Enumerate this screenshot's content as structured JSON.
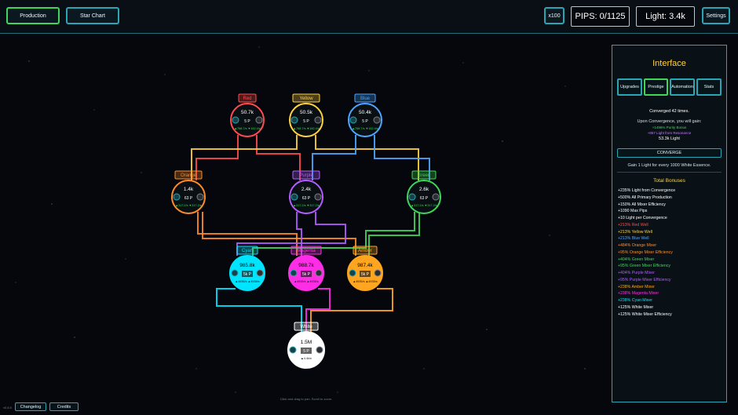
{
  "header": {
    "production_label": "Production",
    "star_chart_label": "Star Chart",
    "multiplier_label": "x100",
    "pips": "PIPS: 0/1125",
    "light": "Light: 3.4k",
    "settings_label": "Settings"
  },
  "nodes": [
    {
      "id": "red",
      "label": "Red",
      "value": "50.7k",
      "pips": "5 P",
      "rate": "▲768.7/s ▼162.4/s",
      "color": "#ff4d4d"
    },
    {
      "id": "yellow",
      "label": "Yellow",
      "value": "50.5k",
      "pips": "5 P",
      "rate": "▲768.7/s ▼162.4/s",
      "color": "#ffd23f"
    },
    {
      "id": "blue",
      "label": "Blue",
      "value": "50.4k",
      "pips": "5 P",
      "rate": "▲768.7/s ▼162.4/s",
      "color": "#4da6ff"
    },
    {
      "id": "orange",
      "label": "Orange",
      "value": "1.4k",
      "pips": "63 P",
      "rate": "▲317.2/s ▼317.2/s",
      "color": "#ff8c2a"
    },
    {
      "id": "purple",
      "label": "Purple",
      "value": "2.4k",
      "pips": "63 P",
      "rate": "▲317.2/s ▼317.2/s",
      "color": "#b35cff"
    },
    {
      "id": "green",
      "label": "Green",
      "value": "2.6k",
      "pips": "63 P",
      "rate": "▲317.2/s ▼317.2/s",
      "color": "#3fd65a"
    },
    {
      "id": "cyan",
      "label": "Cyan",
      "value": "985.8k",
      "pips": "5k P",
      "rate": "▲4935/s ▲4935/s",
      "color": "#00e5ff"
    },
    {
      "id": "magenta",
      "label": "Magenta",
      "value": "988.7k",
      "pips": "5k P",
      "rate": "▲4935/s ▲4935/s",
      "color": "#ff2ee6"
    },
    {
      "id": "amber",
      "label": "Amber",
      "value": "987.4k",
      "pips": "5k P",
      "rate": "▲4935/s ▲4935/s",
      "color": "#ffa51f"
    },
    {
      "id": "white",
      "label": "White",
      "value": "1.5M",
      "pips": "5 P",
      "rate": "▲4.4k/s",
      "color": "#ffffff"
    }
  ],
  "panel": {
    "title": "Interface",
    "tabs": [
      "Upgrades",
      "Prestige",
      "Automation",
      "Stats"
    ],
    "converged": "Converged 42 times.",
    "upon": "Upon Convergence, you will gain:",
    "gain1": "+1496% Purity Bonus",
    "gain2": "+857 Light from Resonance",
    "gain3": "53.3k Light",
    "converge_label": "CONVERGE",
    "gain_rule": "Gain 1 Light for every 1000 White Essence.",
    "bonuses_title": "Total Bonuses",
    "bonuses": [
      {
        "text": "+235% Light from Convergence",
        "color": "#ffffff"
      },
      {
        "text": "+500% All Primary Production",
        "color": "#ffffff"
      },
      {
        "text": "+150% All Mixer Efficiency",
        "color": "#ffffff"
      },
      {
        "text": "+1090 Max Pips",
        "color": "#ffffff"
      },
      {
        "text": "+10 Light per Convergence",
        "color": "#ffffff"
      },
      {
        "text": "+213% Red Well",
        "color": "#ff4d4d"
      },
      {
        "text": "+213% Yellow Well",
        "color": "#ffd23f"
      },
      {
        "text": "+213% Blue Well",
        "color": "#4da6ff"
      },
      {
        "text": "+484% Orange Mixer",
        "color": "#ff8c2a"
      },
      {
        "text": "+95% Orange Mixer Efficiency",
        "color": "#ff8c2a"
      },
      {
        "text": "+404% Green Mixer",
        "color": "#3fd65a"
      },
      {
        "text": "+95% Green Mixer Efficiency",
        "color": "#3fd65a"
      },
      {
        "text": "+404% Purple Mixer",
        "color": "#b35cff"
      },
      {
        "text": "+95% Purple Mixer Efficiency",
        "color": "#b35cff"
      },
      {
        "text": "+238% Amber Mixer",
        "color": "#ffa51f"
      },
      {
        "text": "+238% Magenta Mixer",
        "color": "#ff2ee6"
      },
      {
        "text": "+238% Cyan Mixer",
        "color": "#00e5ff"
      },
      {
        "text": "+125% White Mixer",
        "color": "#ffffff"
      },
      {
        "text": "+125% White Mixer Efficiency",
        "color": "#ffffff"
      }
    ]
  },
  "footer": {
    "version": "v0.8.5",
    "changelog_label": "Changelog",
    "credits_label": "Credits",
    "center_note": "Click and drag to pan. Scroll to zoom."
  }
}
